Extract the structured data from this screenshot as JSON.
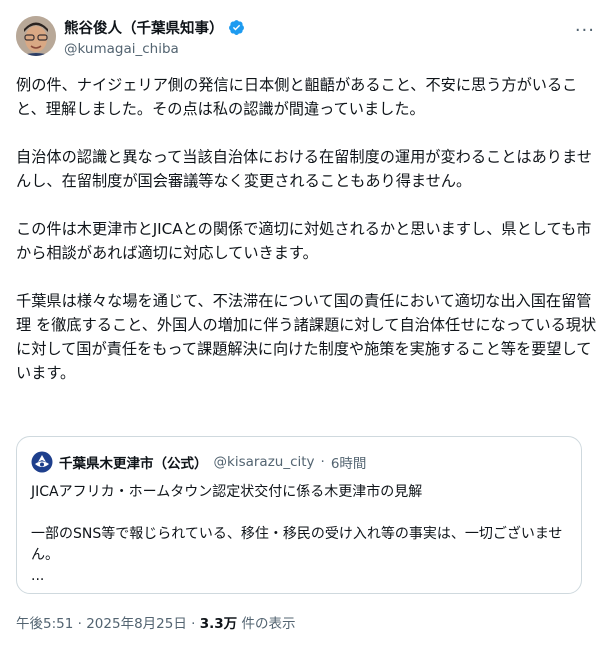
{
  "tweet": {
    "display_name": "熊谷俊人（千葉県知事）",
    "handle": "@kumagai_chiba",
    "more_icon": "more-horizontal-icon",
    "verified_color": "#1d9bf0",
    "paragraphs": [
      "例の件、ナイジェリア側の発信に日本側と齟齬があること、不安に思う方がいること、理解しました。その点は私の認識が間違っていました。",
      "自治体の認識と異なって当該自治体における在留制度の運用が変わることはありませんし、在留制度が国会審議等なく変更されることもあり得ません。",
      "この件は木更津市とJICAとの関係で適切に対処されるかと思いますし、県としても市から相談があれば適切に対応していきます。",
      "千葉県は様々な場を通じて、不法滞在について国の責任において適切な出入国在留管理 を徹底すること、外国人の増加に伴う諸課題に対して自治体任せになっている現状に対して国が責任をもって課題解決に向けた制度や施策を実施すること等を要望しています。"
    ]
  },
  "quote": {
    "name": "千葉県木更津市（公式）",
    "handle": "@kisarazu_city",
    "separator": "·",
    "time": "6時間",
    "line1": "JICAアフリカ・ホームタウン認定状交付に係る木更津市の見解",
    "line2": "一部のSNS等で報じられている、移住・移民の受け入れ等の事実は、一切ございません。",
    "ellipsis": "..."
  },
  "footer": {
    "time": "午後5:51",
    "sep1": "·",
    "date": "2025年8月25日",
    "sep2": "·",
    "views_count": "3.3万",
    "views_label": "件の表示"
  }
}
